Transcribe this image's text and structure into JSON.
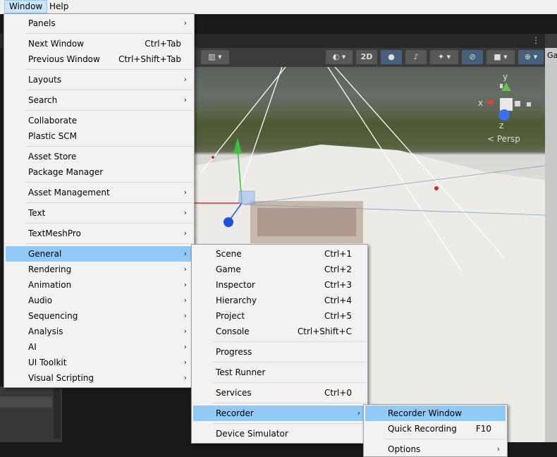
{
  "menubar": {
    "items": [
      {
        "label": "Window",
        "active": true
      },
      {
        "label": "Help",
        "active": false
      }
    ]
  },
  "window_menu": {
    "items": [
      {
        "label": "Panels",
        "submenu": true
      },
      {
        "label": "Next Window",
        "shortcut": "Ctrl+Tab"
      },
      {
        "label": "Previous Window",
        "shortcut": "Ctrl+Shift+Tab"
      },
      {
        "label": "Layouts",
        "submenu": true
      },
      {
        "label": "Search",
        "submenu": true
      },
      {
        "label": "Collaborate"
      },
      {
        "label": "Plastic SCM"
      },
      {
        "label": "Asset Store"
      },
      {
        "label": "Package Manager"
      },
      {
        "label": "Asset Management",
        "submenu": true
      },
      {
        "label": "Text",
        "submenu": true
      },
      {
        "label": "TextMeshPro",
        "submenu": true
      },
      {
        "label": "General",
        "submenu": true,
        "highlighted": true
      },
      {
        "label": "Rendering",
        "submenu": true
      },
      {
        "label": "Animation",
        "submenu": true
      },
      {
        "label": "Audio",
        "submenu": true
      },
      {
        "label": "Sequencing",
        "submenu": true
      },
      {
        "label": "Analysis",
        "submenu": true
      },
      {
        "label": "AI",
        "submenu": true
      },
      {
        "label": "UI Toolkit",
        "submenu": true
      },
      {
        "label": "Visual Scripting",
        "submenu": true
      }
    ]
  },
  "general_menu": {
    "items": [
      {
        "label": "Scene",
        "shortcut": "Ctrl+1"
      },
      {
        "label": "Game",
        "shortcut": "Ctrl+2"
      },
      {
        "label": "Inspector",
        "shortcut": "Ctrl+3"
      },
      {
        "label": "Hierarchy",
        "shortcut": "Ctrl+4"
      },
      {
        "label": "Project",
        "shortcut": "Ctrl+5"
      },
      {
        "label": "Console",
        "shortcut": "Ctrl+Shift+C"
      },
      {
        "label": "Progress"
      },
      {
        "label": "Test Runner"
      },
      {
        "label": "Services",
        "shortcut": "Ctrl+0"
      },
      {
        "label": "Recorder",
        "submenu": true,
        "highlighted": true
      },
      {
        "label": "Device Simulator"
      }
    ]
  },
  "recorder_menu": {
    "items": [
      {
        "label": "Recorder Window",
        "highlighted": true
      },
      {
        "label": "Quick Recording",
        "shortcut": "F10"
      },
      {
        "label": "Options",
        "submenu": true
      }
    ]
  },
  "scene_toolbar": {
    "mode_2d": "2D"
  },
  "gizmo": {
    "x": "x",
    "y": "y",
    "z": "z",
    "projection": "< Persp"
  },
  "right_panel": {
    "tab_label": "Ga"
  },
  "icons": {
    "submenu_arrow": "chevron-right-icon",
    "more": "kebab-menu-icon"
  },
  "colors": {
    "menu_highlight": "#91c9f7",
    "menu_bg": "#f2f2f2",
    "editor_dark": "#282828"
  }
}
